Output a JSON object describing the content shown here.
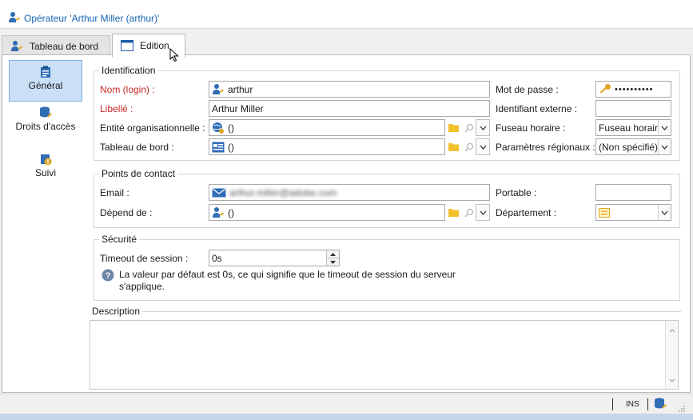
{
  "window": {
    "title": "Opérateur 'Arthur Miller (arthur)'"
  },
  "tabs": [
    {
      "label": "Tableau de bord",
      "icon": "operator-icon"
    },
    {
      "label": "Edition",
      "icon": "window-icon"
    }
  ],
  "sidebar": {
    "items": [
      {
        "label": "Général",
        "icon": "clipboard-icon",
        "selected": true
      },
      {
        "label": "Droits d'accès",
        "icon": "database-key-icon"
      },
      {
        "label": "Suivi",
        "icon": "info-badge-icon"
      }
    ]
  },
  "identification": {
    "title": "Identification",
    "login_label": "Nom (login) :",
    "login_value": "arthur",
    "libelle_label": "Libellé :",
    "libelle_value": "Arthur Miller",
    "entite_label": "Entité organisationnelle :",
    "entite_value": "()",
    "tableau_label": "Tableau de bord :",
    "tableau_value": "()",
    "password_label": "Mot de passe :",
    "password_value": "••••••••••",
    "ext_id_label": "Identifiant externe :",
    "ext_id_value": "",
    "tz_label": "Fuseau horaire :",
    "tz_value": "Fuseau horaire",
    "regional_label": "Paramètres régionaux :",
    "regional_value": "(Non spécifié)"
  },
  "contact": {
    "title": "Points de contact",
    "email_label": "Email :",
    "email_value": "arthur.miller@adobe.com",
    "depend_label": "Dépend de :",
    "depend_value": "()",
    "portable_label": "Portable :",
    "portable_value": "",
    "departement_label": "Département :",
    "departement_value": ""
  },
  "security": {
    "title": "Sécurité",
    "timeout_label": "Timeout de session :",
    "timeout_value": "0s",
    "info_text": "La valeur par défaut est 0s, ce qui signifie que le timeout de session du serveur s'applique."
  },
  "description": {
    "title": "Description",
    "value": ""
  },
  "status": {
    "mode": "INS"
  },
  "colors": {
    "title_blue": "#1565b0",
    "required_red": "#c62828",
    "selected_nav": "#c9e0f7"
  }
}
